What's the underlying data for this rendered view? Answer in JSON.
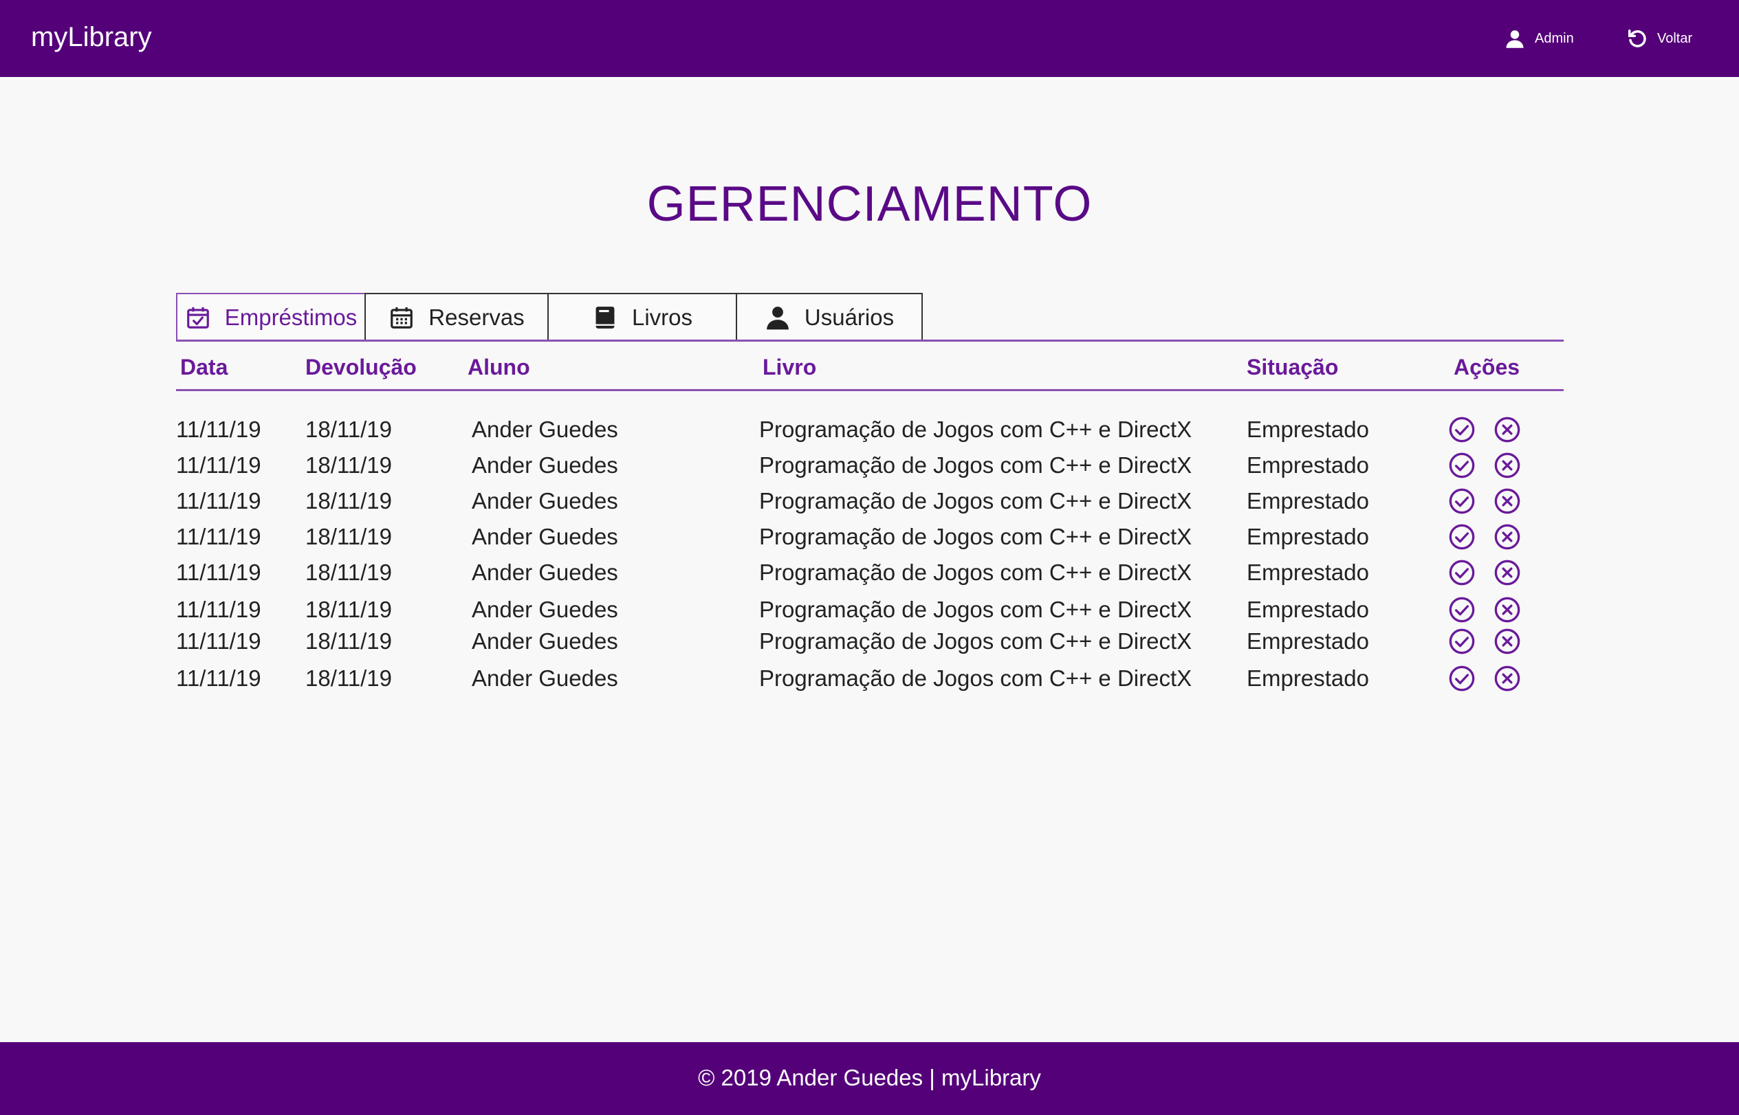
{
  "header": {
    "brand": "myLibrary",
    "admin_label": "Admin",
    "back_label": "Voltar"
  },
  "page": {
    "title": "GERENCIAMENTO"
  },
  "tabs": [
    {
      "label": "Empréstimos",
      "icon": "calendar-check-icon",
      "active": true
    },
    {
      "label": "Reservas",
      "icon": "calendar-icon",
      "active": false
    },
    {
      "label": "Livros",
      "icon": "book-icon",
      "active": false
    },
    {
      "label": "Usuários",
      "icon": "user-icon",
      "active": false
    }
  ],
  "table": {
    "headers": {
      "data": "Data",
      "devolucao": "Devolução",
      "aluno": "Aluno",
      "livro": "Livro",
      "situacao": "Situação",
      "acoes": "Ações"
    },
    "rows": [
      {
        "data": "11/11/19",
        "devolucao": "18/11/19",
        "aluno": "Ander Guedes",
        "livro": "Programação de Jogos com C++ e DirectX",
        "situacao": "Emprestado"
      },
      {
        "data": "11/11/19",
        "devolucao": "18/11/19",
        "aluno": "Ander Guedes",
        "livro": "Programação de Jogos com C++ e DirectX",
        "situacao": "Emprestado"
      },
      {
        "data": "11/11/19",
        "devolucao": "18/11/19",
        "aluno": "Ander Guedes",
        "livro": "Programação de Jogos com C++ e DirectX",
        "situacao": "Emprestado"
      },
      {
        "data": "11/11/19",
        "devolucao": "18/11/19",
        "aluno": "Ander Guedes",
        "livro": "Programação de Jogos com C++ e DirectX",
        "situacao": "Emprestado"
      },
      {
        "data": "11/11/19",
        "devolucao": "18/11/19",
        "aluno": "Ander Guedes",
        "livro": "Programação de Jogos com C++ e DirectX",
        "situacao": "Emprestado"
      },
      {
        "data": "11/11/19",
        "devolucao": "18/11/19",
        "aluno": "Ander Guedes",
        "livro": "Programação de Jogos com C++ e DirectX",
        "situacao": "Emprestado"
      },
      {
        "data": "11/11/19",
        "devolucao": "18/11/19",
        "aluno": "Ander Guedes",
        "livro": "Programação de Jogos com C++ e DirectX",
        "situacao": "Emprestado"
      },
      {
        "data": "11/11/19",
        "devolucao": "18/11/19",
        "aluno": "Ander Guedes",
        "livro": "Programação de Jogos com C++ e DirectX",
        "situacao": "Emprestado"
      }
    ]
  },
  "footer": {
    "text": "© 2019 Ander Guedes | myLibrary"
  },
  "colors": {
    "brand": "#540079",
    "accent": "#6a1a9a",
    "background": "#f8f8f8"
  }
}
